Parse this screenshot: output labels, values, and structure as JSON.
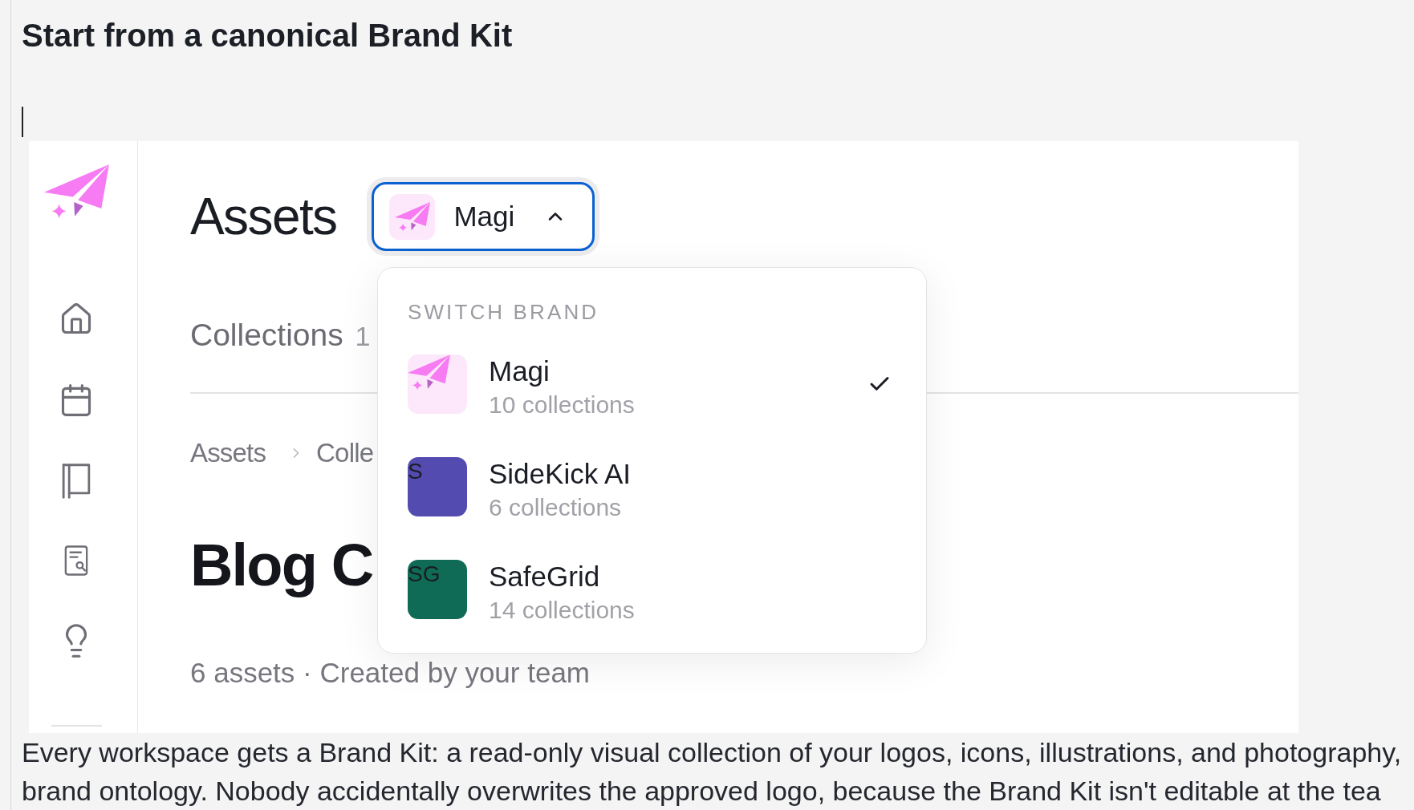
{
  "heading": "Start from a canonical Brand Kit",
  "app": {
    "page_title": "Assets",
    "brand_switcher": {
      "current": "Magi",
      "expanded": true
    },
    "tab": {
      "label": "Collections",
      "count": "1"
    },
    "breadcrumb": [
      "Assets",
      "Colle"
    ],
    "collection_title": "Blog C",
    "collection_meta": "6 assets · Created by your team",
    "brand_menu": {
      "title": "SWITCH BRAND",
      "items": [
        {
          "kind": "logo",
          "name": "Magi",
          "subtitle": "10 collections",
          "color": "#fde7fb",
          "selected": true
        },
        {
          "kind": "initials",
          "initials": "S",
          "name": "SideKick AI",
          "subtitle": "6 collections",
          "color": "#534bb0",
          "selected": false
        },
        {
          "kind": "initials",
          "initials": "SG",
          "name": "SafeGrid",
          "subtitle": "14 collections",
          "color": "#0f6b55",
          "selected": false
        }
      ]
    }
  },
  "body_lines": [
    "Every workspace gets a Brand Kit: a read-only visual collection of your logos, icons, illustrations, and photography,",
    "brand ontology. Nobody accidentally overwrites the approved logo, because the Brand Kit isn't editable at the tea"
  ]
}
